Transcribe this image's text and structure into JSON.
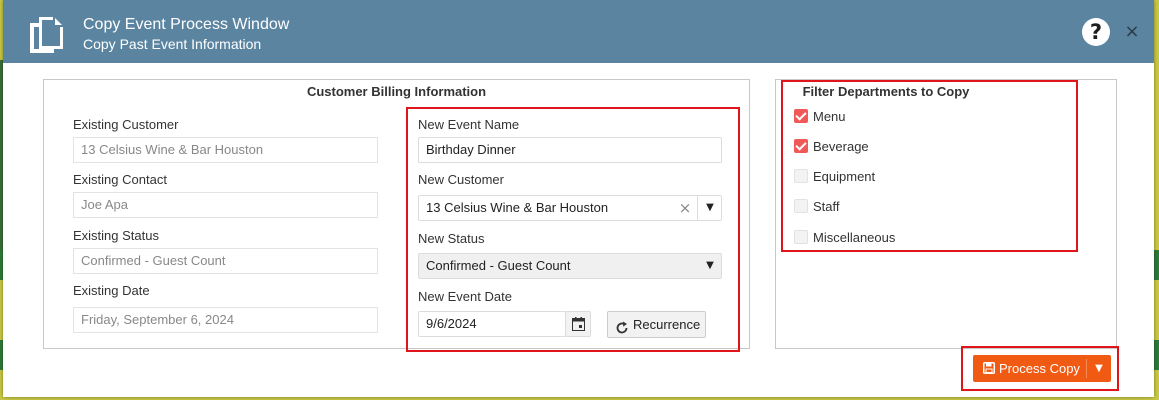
{
  "window": {
    "title": "Copy Event Process Window",
    "subtitle": "Copy Past Event Information",
    "help_label": "?",
    "close_label": "×"
  },
  "billing": {
    "title": "Customer Billing Information",
    "existing": [
      {
        "label": "Existing Customer",
        "value": "13 Celsius Wine & Bar Houston"
      },
      {
        "label": "Existing Contact",
        "value": "Joe Apa"
      },
      {
        "label": "Existing Status",
        "value": "Confirmed - Guest Count"
      },
      {
        "label": "Existing Date",
        "value": "Friday, September 6, 2024"
      }
    ],
    "new_event_name": {
      "label": "New Event Name",
      "value": "Birthday Dinner"
    },
    "new_customer": {
      "label": "New Customer",
      "value": "13 Celsius Wine & Bar Houston"
    },
    "new_status": {
      "label": "New Status",
      "value": "Confirmed - Guest Count"
    },
    "new_event_date": {
      "label": "New Event Date",
      "value": "9/6/2024"
    },
    "recurrence_label": "Recurrence"
  },
  "filter": {
    "title": "Filter Departments to Copy",
    "items": [
      {
        "label": "Menu",
        "checked": true
      },
      {
        "label": "Beverage",
        "checked": true
      },
      {
        "label": "Equipment",
        "checked": false
      },
      {
        "label": "Staff",
        "checked": false
      },
      {
        "label": "Miscellaneous",
        "checked": false
      }
    ]
  },
  "actions": {
    "process_copy_label": "Process Copy"
  },
  "colors": {
    "header": "#5b84a1",
    "accent": "#f15a12",
    "checkbox_on": "#ef5a58",
    "highlight": "#e0141b"
  }
}
